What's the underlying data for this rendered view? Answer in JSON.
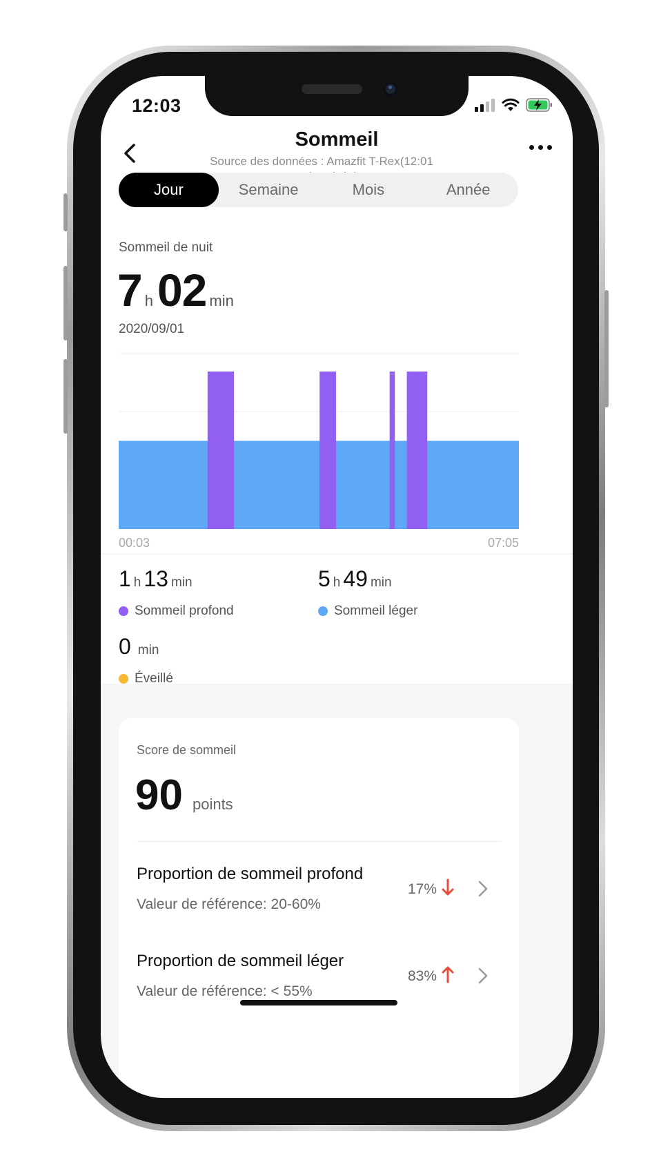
{
  "status_bar": {
    "time": "12:03"
  },
  "header": {
    "title": "Sommeil",
    "source_line1": "Source des données : Amazfit T-Rex(12:01",
    "source_line2": "synchronisée)"
  },
  "tabs": [
    {
      "label": "Jour",
      "active": true
    },
    {
      "label": "Semaine",
      "active": false
    },
    {
      "label": "Mois",
      "active": false
    },
    {
      "label": "Année",
      "active": false
    }
  ],
  "summary": {
    "label": "Sommeil de nuit",
    "hours": "7",
    "hours_unit": "h",
    "minutes": "02",
    "minutes_unit": "min",
    "date": "2020/09/01"
  },
  "chart_data": {
    "type": "area",
    "x_start": "00:03",
    "x_end": "07:05",
    "series": [
      {
        "name": "Sommeil léger",
        "color": "#5ea7f5",
        "level": 0.56
      },
      {
        "name": "Sommeil profond",
        "color": "#9160f2",
        "level": 1.0,
        "segments": [
          {
            "start": 0.222,
            "end": 0.288
          },
          {
            "start": 0.502,
            "end": 0.543
          },
          {
            "start": 0.677,
            "end": 0.69
          },
          {
            "start": 0.72,
            "end": 0.771
          }
        ]
      }
    ],
    "grid": true
  },
  "stats": {
    "deep": {
      "h": "1",
      "h_unit": "h",
      "m": "13",
      "m_unit": "min",
      "label": "Sommeil profond",
      "color": "#9160f2"
    },
    "light": {
      "h": "5",
      "h_unit": "h",
      "m": "49",
      "m_unit": "min",
      "label": "Sommeil léger",
      "color": "#5ea7f5"
    },
    "awake": {
      "m": "0",
      "m_unit": "min",
      "label": "Éveillé",
      "color": "#f5b935"
    }
  },
  "score": {
    "label": "Score de sommeil",
    "value": "90",
    "unit": "points"
  },
  "proportions": [
    {
      "title": "Proportion de sommeil profond",
      "reference": "Valeur de référence: 20-60%",
      "percent": "17%",
      "trend": "down",
      "trend_color": "#e84c3d"
    },
    {
      "title": "Proportion de sommeil léger",
      "reference": "Valeur de référence: < 55%",
      "percent": "83%",
      "trend": "up",
      "trend_color": "#e84c3d"
    }
  ]
}
